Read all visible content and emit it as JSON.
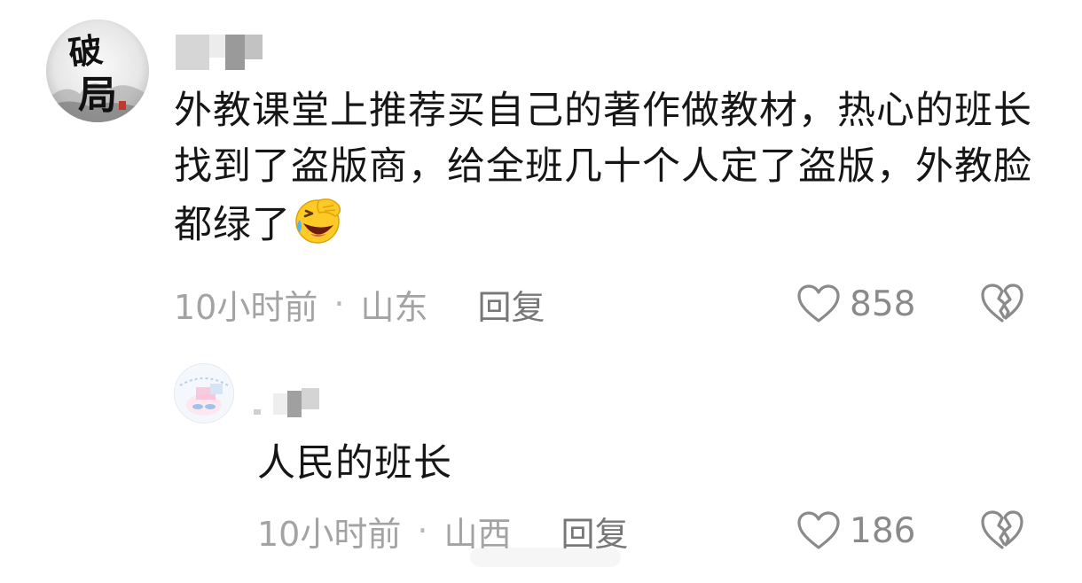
{
  "comments": [
    {
      "text": "外教课堂上推荐买自己的著作做教材，热心的班长找到了盗版商，给全班几十个人定了盗版，外教脸都绿了",
      "emoji": "laughing-face-emoji",
      "time": "10小时前",
      "dot": "·",
      "location": "山东",
      "reply_label": "回复",
      "likes": "858",
      "avatar_glyphs": "破局"
    },
    {
      "text": "人民的班长",
      "time": "10小时前",
      "dot": "·",
      "location": "山西",
      "reply_label": "回复",
      "likes": "186"
    }
  ],
  "icons": {
    "like": "heart-outline-icon",
    "dislike": "broken-heart-icon"
  },
  "colors": {
    "text": "#161616",
    "meta": "#a3a3a3",
    "reply": "#777777",
    "icon": "#8a8a8a"
  }
}
